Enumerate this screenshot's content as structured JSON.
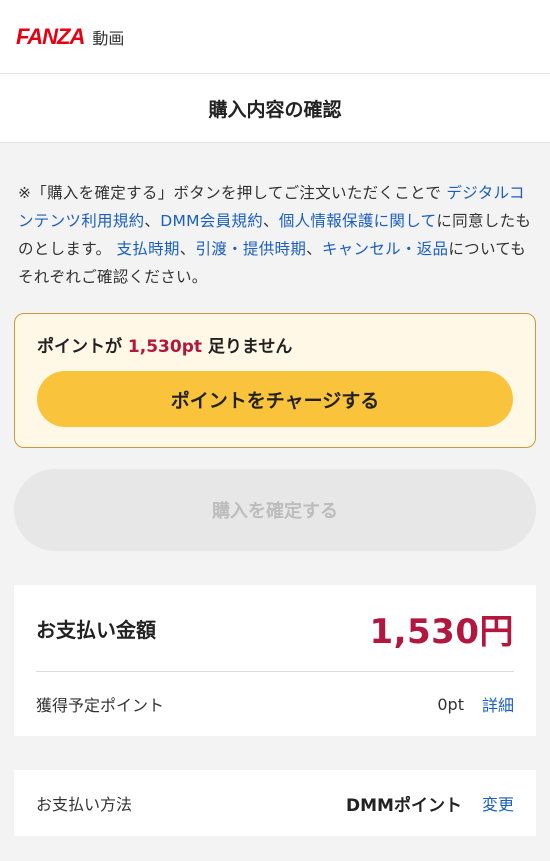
{
  "brand": {
    "logo_text": "FANZA",
    "section": "動画"
  },
  "page_title": "購入内容の確認",
  "notice": {
    "t1": "※「購入を確定する」ボタンを押してご注文いただくことで",
    "link1": "デジタルコンテンツ利用規約",
    "sep1": "、",
    "link2": "DMM会員規約",
    "sep2": "、",
    "link3": "個人情報保護に関して",
    "t2": "に同意したものとします。",
    "link4": "支払時期",
    "sep3": "、",
    "link5": "引渡・提供時期",
    "sep4": "、",
    "link6": "キャンセル・返品",
    "t3": "についてもそれぞれご確認ください。"
  },
  "shortage": {
    "prefix": "ポイントが",
    "amount": "1,530pt",
    "suffix": "足りません",
    "charge_button": "ポイントをチャージする"
  },
  "confirm_button": "購入を確定する",
  "payment": {
    "label": "お支払い金額",
    "amount": "1,530円",
    "points_label": "獲得予定ポイント",
    "points_value": "0pt",
    "points_detail_link": "詳細"
  },
  "method": {
    "label": "お支払い方法",
    "value": "DMMポイント",
    "change_link": "変更"
  },
  "colors": {
    "accent": "#b2173f",
    "link": "#1a5fbf",
    "charge": "#f9c33c",
    "brand_red": "#e60012"
  }
}
